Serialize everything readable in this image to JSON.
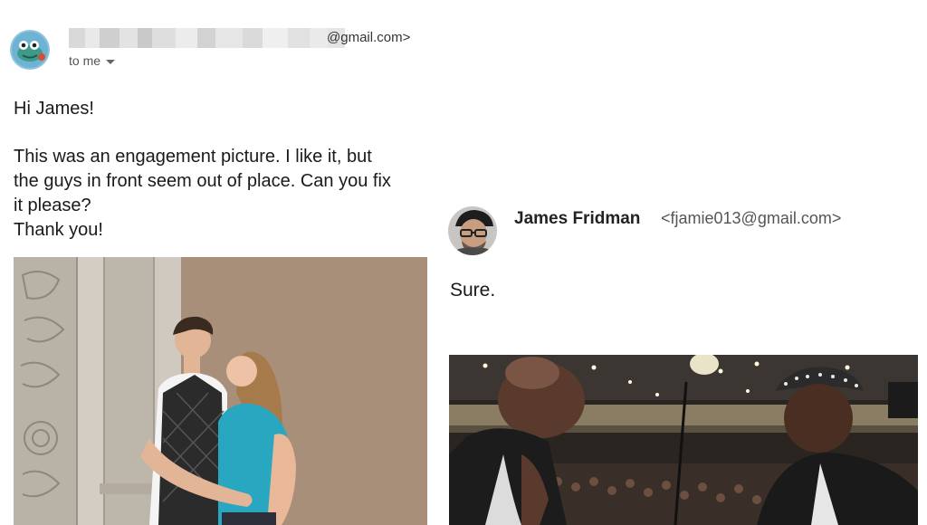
{
  "original_email": {
    "sender_domain": "@gmail.com>",
    "recipient_label": "to me",
    "greeting": "Hi James!",
    "body_lines": [
      "This was an engagement picture. I like it, but",
      "the guys in front seem out of place. Can you fix",
      "it please?",
      "Thank you!"
    ],
    "attachment_icon": "photo-couple-embracing"
  },
  "reply": {
    "sender_name": "James Fridman",
    "sender_email": "<fjamie013@gmail.com>",
    "message": "Sure.",
    "attachment_icon": "photo-lecture-hall"
  },
  "colors": {
    "redaction": [
      "#e8e8e8",
      "#d6d6d6",
      "#c8c8c8"
    ],
    "wall": "#a58e79",
    "shirt": "#2aa7c0"
  }
}
